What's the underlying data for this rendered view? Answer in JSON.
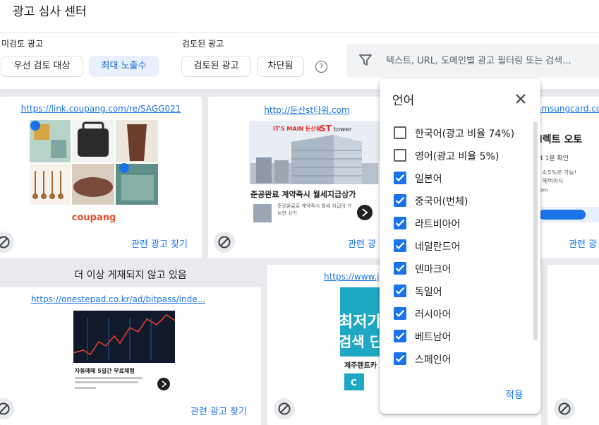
{
  "page_title": "광고 심사 센터",
  "unreviewed": {
    "label": "미검토 광고",
    "chips": [
      "우선 검토 대상",
      "최대 노출수"
    ]
  },
  "reviewed": {
    "label": "검토된 광고",
    "chips": [
      "검토된 광고",
      "차단됨"
    ],
    "help": "?"
  },
  "filter": {
    "placeholder": "텍스트, URL, 도메인별 광고 필터링 또는 검색..."
  },
  "cards": [
    {
      "url": "https://link.coupang.com/re/SAGG021",
      "brand": "coupang",
      "find_label": "관련 광고 찾기"
    },
    {
      "url": "http://둔산st타워.com",
      "headline": "준공완료 계약즉시 월세지급상가",
      "sub": "준공완료로 계약즉시 월세 지급이 가능한 상가",
      "brand_top": "IT'S MAIN 둔산동",
      "brand_st": "ST",
      "brand_tower": "tower",
      "find_label": "관련 광"
    },
    {
      "url": "amsungcard.com",
      "text1": "l렉트 오토",
      "text2": "4 1분 확인",
      "text3": "l 4.5%로 가능!",
      "text4": "l 혜택까지",
      "text5": "om",
      "find_label": "관련 광"
    },
    {
      "banner": "더 이상 게재되지 않고 있음",
      "url": "https://onestepad.co.kr/ad/bitpass/inde...",
      "headline": "자동매매 5일간 무료체험",
      "find_label": "관련 광고 찾기"
    },
    {
      "url": "https://www.jej",
      "big1": "최저가",
      "big2": "검색 딘",
      "caption": "제주렌트카",
      "chip_letter": "C"
    },
    {
      "url": ""
    }
  ],
  "language_panel": {
    "title": "언어",
    "apply_label": "적용",
    "items": [
      {
        "label": "한국어(광고 비율 74%)",
        "checked": false
      },
      {
        "label": "영어(광고 비율 5%)",
        "checked": false
      },
      {
        "label": "일본어",
        "checked": true
      },
      {
        "label": "중국어(번체)",
        "checked": true
      },
      {
        "label": "라트비아어",
        "checked": true
      },
      {
        "label": "네덜란드어",
        "checked": true
      },
      {
        "label": "덴마크어",
        "checked": true
      },
      {
        "label": "독일어",
        "checked": true
      },
      {
        "label": "러시아어",
        "checked": true
      },
      {
        "label": "베트남어",
        "checked": true
      },
      {
        "label": "스페인어",
        "checked": true
      }
    ]
  },
  "colors": {
    "accent": "#1a73e8",
    "chip_selected_bg": "#e8f0fe",
    "grid_bg": "#e8eaed"
  },
  "icons": {
    "filter": "filter-icon",
    "help": "help-circle-icon",
    "close": "close-icon",
    "block": "block-icon",
    "check": "check-icon",
    "arrow": "arrow-right-icon",
    "ad_choices": "ad-choices-icon"
  }
}
